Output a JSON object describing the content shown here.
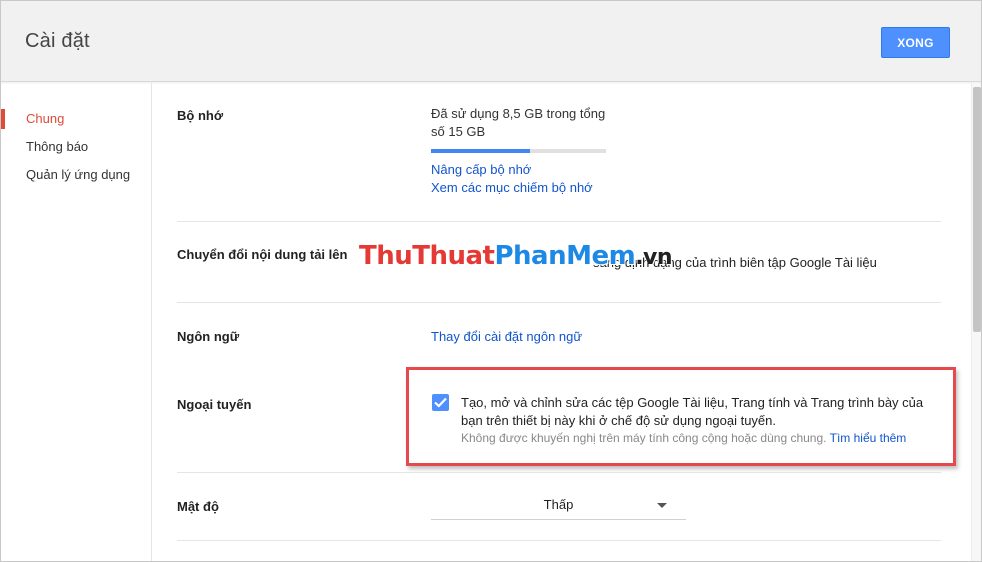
{
  "header": {
    "title": "Cài đặt",
    "done_label": "XONG"
  },
  "sidebar": {
    "items": [
      {
        "label": "Chung",
        "active": true
      },
      {
        "label": "Thông báo",
        "active": false
      },
      {
        "label": "Quản lý ứng dụng",
        "active": false
      }
    ]
  },
  "storage": {
    "label": "Bộ nhớ",
    "usage_text": "Đã sử dụng 8,5 GB trong tổng số 15 GB",
    "used_fraction": 0.567,
    "upgrade_link": "Nâng cấp bộ nhớ",
    "view_link": "Xem các mục chiếm bộ nhớ"
  },
  "convert": {
    "label": "Chuyển đổi nội dung tải lên",
    "text": "sang định dạng của trình biên tập Google Tài liệu"
  },
  "watermark": {
    "part1": "ThuThuat",
    "part2": "PhanMem",
    "part3": ".vn"
  },
  "language": {
    "label": "Ngôn ngữ",
    "link": "Thay đổi cài đặt ngôn ngữ"
  },
  "offline": {
    "label": "Ngoại tuyến",
    "checked": true,
    "text": "Tạo, mở và chỉnh sửa các tệp Google Tài liệu, Trang tính và Trang trình bày của bạn trên thiết bị này khi ở chế độ sử dụng ngoại tuyến.",
    "note": "Không được khuyến nghị trên máy tính công cộng hoặc dùng chung.",
    "learn_more": "Tìm hiểu thêm"
  },
  "density": {
    "label": "Mật độ",
    "value": "Thấp"
  },
  "colors": {
    "accent_blue": "#4d90fe",
    "active_red": "#dd4b39",
    "link_blue": "#1155cc",
    "highlight_red": "#e5484d"
  }
}
